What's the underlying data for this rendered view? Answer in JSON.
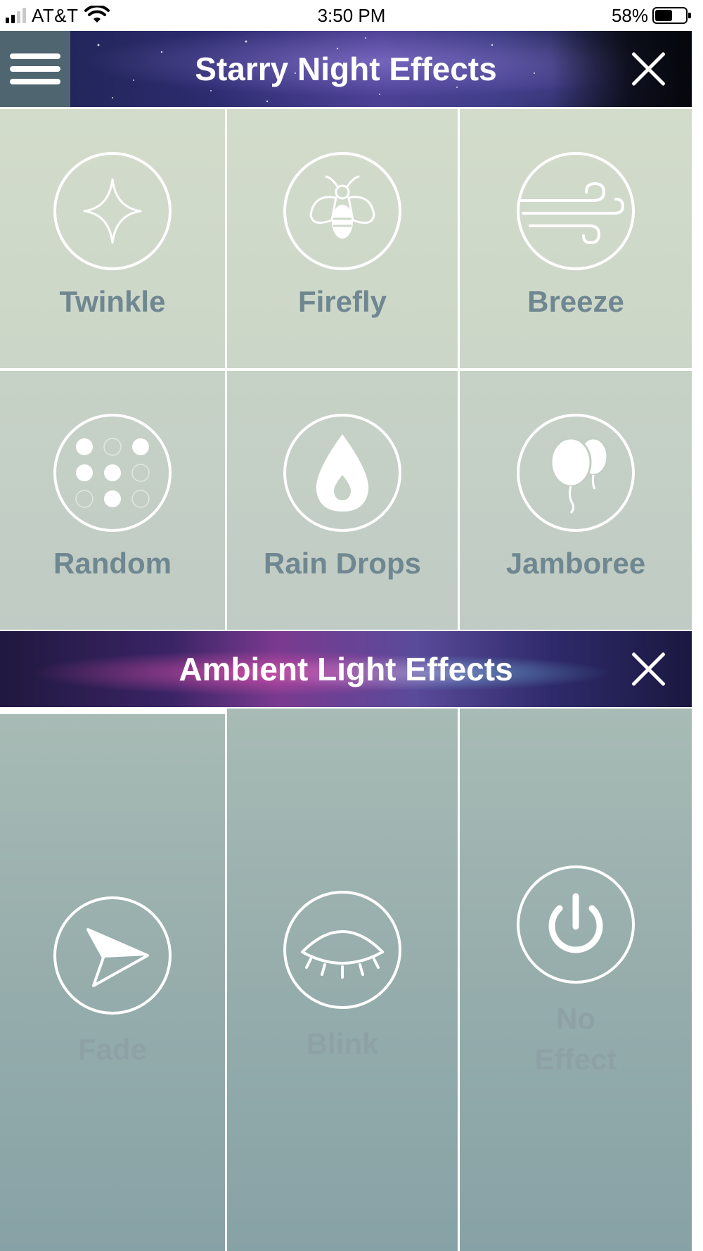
{
  "status_bar": {
    "carrier": "AT&T",
    "time": "3:50 PM",
    "battery": "58%",
    "battery_level": 0.58,
    "signal_bars": 2
  },
  "starry_header": {
    "title": "Starry Night Effects"
  },
  "starry_effects": [
    {
      "label": "Twinkle",
      "icon": "sparkle-icon"
    },
    {
      "label": "Firefly",
      "icon": "firefly-icon"
    },
    {
      "label": "Breeze",
      "icon": "wind-icon"
    },
    {
      "label": "Random",
      "icon": "dots-grid-icon"
    },
    {
      "label": "Rain Drops",
      "icon": "droplet-icon"
    },
    {
      "label": "Jamboree",
      "icon": "balloons-icon"
    }
  ],
  "ambient_header": {
    "title": "Ambient Light Effects"
  },
  "ambient_effects": [
    {
      "label": "Fade",
      "icon": "paper-plane-icon"
    },
    {
      "label": "Blink",
      "icon": "closed-eye-icon"
    },
    {
      "label": "No Effect",
      "icon": "power-icon"
    }
  ],
  "colors": {
    "tile_label": "#6f8790",
    "ambient_label": "#8ea2a6",
    "menu_bg": "#4f6670"
  }
}
